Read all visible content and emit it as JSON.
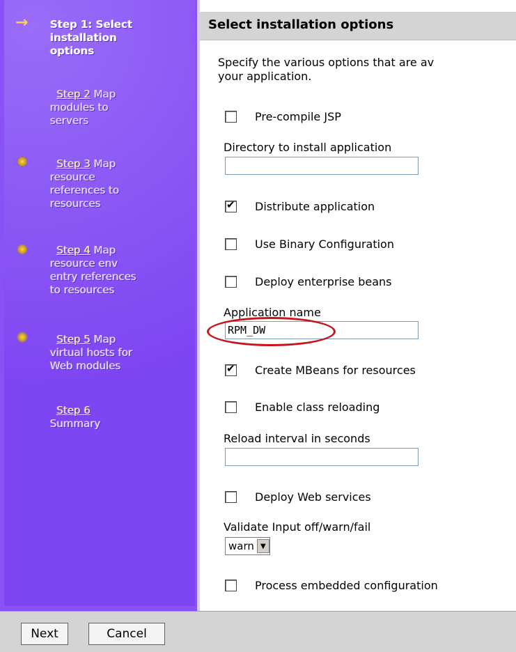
{
  "sidebar": {
    "steps": [
      {
        "line1": "Step 1: Select",
        "line2": "installation",
        "line3": "options"
      },
      {
        "link": "Step 2",
        "text1": " Map",
        "line2": "modules to",
        "line3": "servers"
      },
      {
        "link": "Step 3",
        "text1": " Map",
        "line2": "resource",
        "line3": "references to",
        "line4": "resources"
      },
      {
        "link": "Step 4",
        "text1": " Map",
        "line2": "resource env",
        "line3": "entry references",
        "line4": "to resources"
      },
      {
        "link": "Step 5",
        "text1": " Map",
        "line2": "virtual hosts for",
        "line3": "Web modules"
      },
      {
        "link": "Step 6",
        "line2": "Summary"
      }
    ]
  },
  "main": {
    "title": "Select installation options",
    "description_line1": "Specify the various options that are av",
    "description_line2": "your application.",
    "options": {
      "precompile_jsp": {
        "label": "Pre-compile JSP",
        "checked": false
      },
      "install_dir_label": "Directory to install application",
      "install_dir_value": "",
      "distribute": {
        "label": "Distribute application",
        "checked": true
      },
      "binary_config": {
        "label": "Use Binary Configuration",
        "checked": false
      },
      "deploy_ejb": {
        "label": "Deploy enterprise beans",
        "checked": false
      },
      "app_name_label": "Application name",
      "app_name_value": "RPM_DW",
      "create_mbeans": {
        "label": "Create MBeans for resources",
        "checked": true
      },
      "class_reload": {
        "label": "Enable class reloading",
        "checked": false
      },
      "reload_interval_label": "Reload interval in seconds",
      "reload_interval_value": "",
      "deploy_ws": {
        "label": "Deploy Web services",
        "checked": false
      },
      "validate_label": "Validate Input off/warn/fail",
      "validate_value": "warn",
      "embedded_config": {
        "label": "Process embedded configuration",
        "checked": false
      }
    }
  },
  "footer": {
    "next_label": "Next",
    "cancel_label": "Cancel"
  },
  "colors": {
    "sidebar": "#7e45f2",
    "highlight_oval": "#c4161c",
    "header": "#d4d4d4"
  }
}
